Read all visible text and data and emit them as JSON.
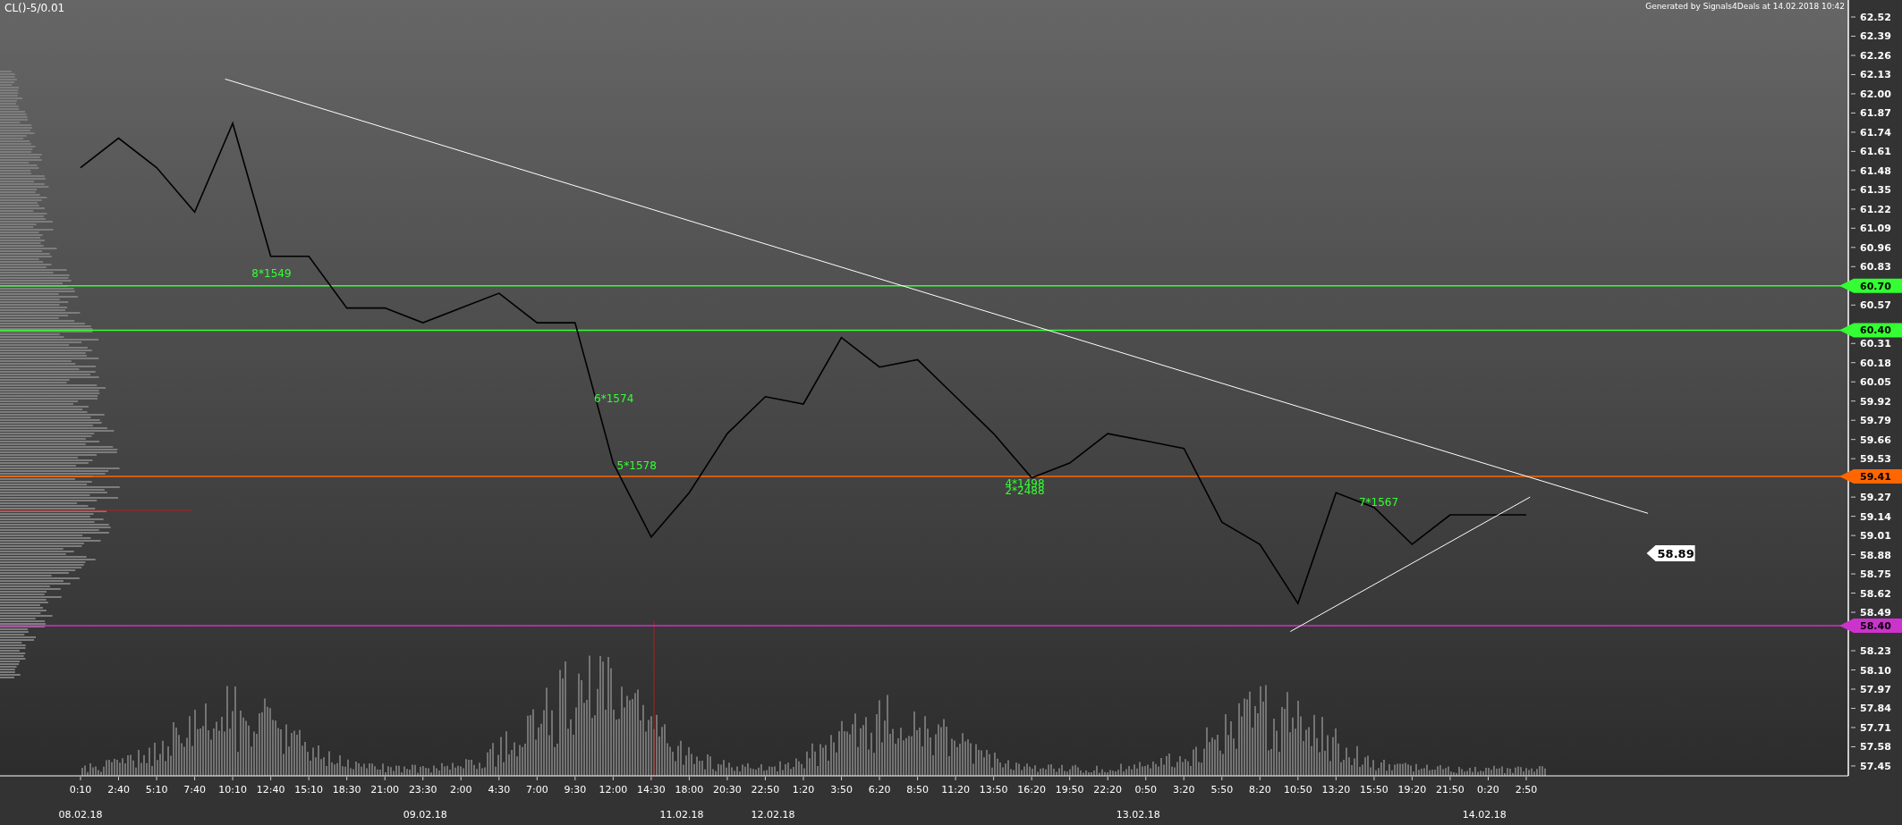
{
  "header": {
    "symbol": "CL()-5/0.01",
    "credit": "Generated by Signals4Deals at 14.02.2018 10:42"
  },
  "chart": {
    "chart_data": {
      "type": "line",
      "ylim": [
        57.383,
        62.635
      ],
      "categories": [
        "0:10",
        "2:40",
        "5:10",
        "7:40",
        "10:10",
        "12:40",
        "15:10",
        "18:30",
        "21:00",
        "23:30",
        "2:00",
        "4:30",
        "7:00",
        "9:30",
        "12:00",
        "14:30",
        "18:00",
        "20:30",
        "22:50",
        "1:20",
        "3:50",
        "6:20",
        "8:50",
        "11:20",
        "13:50",
        "16:20",
        "19:50",
        "22:20",
        "0:50",
        "3:20",
        "5:50",
        "8:20",
        "10:50",
        "13:20",
        "15:50",
        "19:20",
        "21:50",
        "0:20",
        "2:50"
      ],
      "series": [
        {
          "color": "#000000",
          "values": [
            61.5,
            61.7,
            61.5,
            61.2,
            61.8,
            60.9,
            60.9,
            60.55,
            60.55,
            60.45,
            60.55,
            60.65,
            60.45,
            60.45,
            59.5,
            59.0,
            59.3,
            59.7,
            59.95,
            59.9,
            60.35,
            60.15,
            60.2,
            59.95,
            59.7,
            59.4,
            59.5,
            59.7,
            59.65,
            59.6,
            59.1,
            58.95,
            58.55,
            59.3,
            59.2,
            58.95,
            59.15,
            59.15,
            59.15
          ]
        }
      ],
      "yticks": [
        62.52,
        62.39,
        62.26,
        62.13,
        {
          "value": 62.0,
          "label": "62.00"
        },
        61.87,
        61.74,
        61.61,
        61.48,
        61.35,
        61.22,
        61.09,
        60.96,
        60.83,
        60.57,
        60.31,
        60.18,
        60.05,
        59.92,
        59.79,
        59.66,
        59.53,
        59.27,
        59.14,
        59.01,
        58.88,
        58.75,
        58.62,
        58.49,
        58.23,
        {
          "value": 58.1,
          "label": "58.10"
        },
        57.97,
        57.84,
        57.71,
        57.58,
        57.45
      ],
      "annotations": [
        "8*1549",
        "6*1574",
        "5*1578",
        "4*1498",
        "2*2488",
        "7*1567"
      ]
    }
  },
  "levels": [
    {
      "label": "60.70",
      "color": "#33ff33"
    },
    {
      "label": "60.40",
      "color": "#33ff33"
    },
    {
      "label": "59.41",
      "color": "#ff6600"
    },
    {
      "label": "58.40",
      "color": "#cc33cc"
    }
  ],
  "current_price": "58.89",
  "dates": [
    "08.02.18",
    "09.02.18",
    "11.02.18",
    "12.02.18",
    "13.02.18",
    "14.02.18"
  ]
}
